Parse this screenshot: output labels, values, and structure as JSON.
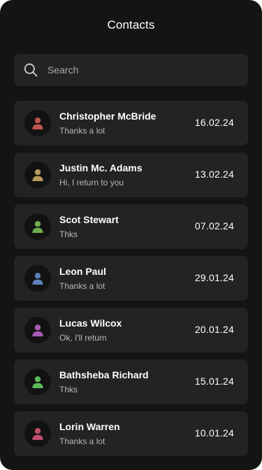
{
  "header": {
    "title": "Contacts"
  },
  "search": {
    "placeholder": "Search",
    "value": ""
  },
  "contacts": [
    {
      "name": "Christopher McBride",
      "message": "Thanks a lot",
      "date": "16.02.24",
      "avatar_color": "#c0564e"
    },
    {
      "name": "Justin Mc. Adams",
      "message": "Hi, I return to you",
      "date": "13.02.24",
      "avatar_color": "#b79a5c"
    },
    {
      "name": "Scot Stewart",
      "message": "Thks",
      "date": "07.02.24",
      "avatar_color": "#6fae4e"
    },
    {
      "name": "Leon Paul",
      "message": "Thanks a lot",
      "date": "29.01.24",
      "avatar_color": "#5d80b8"
    },
    {
      "name": "Lucas Wilcox",
      "message": "Ok, I'll return",
      "date": "20.01.24",
      "avatar_color": "#a65cb4"
    },
    {
      "name": "Bathsheba Richard",
      "message": "Thks",
      "date": "15.01.24",
      "avatar_color": "#5cb85c"
    },
    {
      "name": "Lorin Warren",
      "message": "Thanks a lot",
      "date": "10.01.24",
      "avatar_color": "#c04f6a"
    }
  ]
}
